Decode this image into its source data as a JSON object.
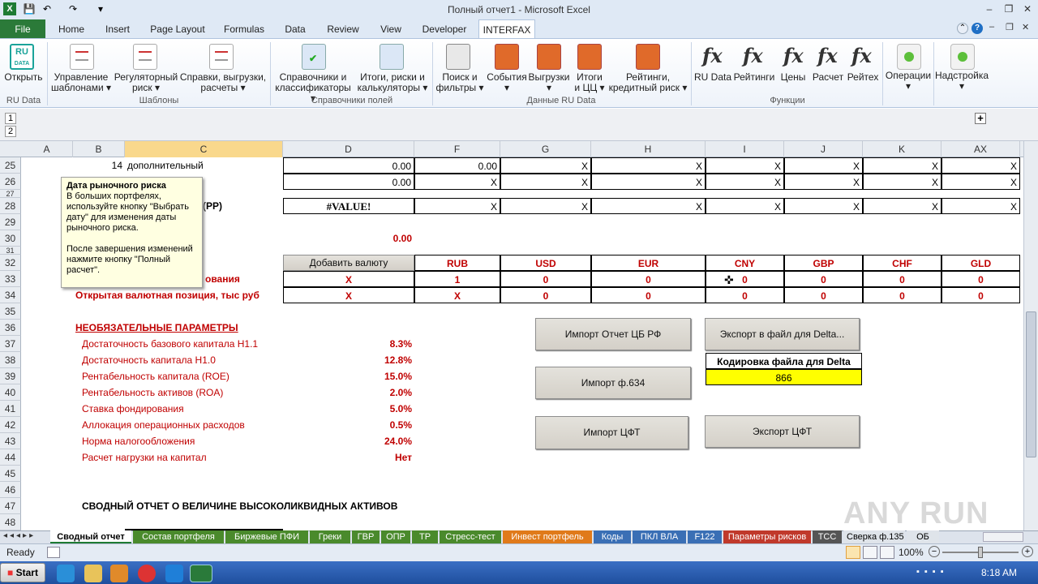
{
  "window": {
    "title": "Полный отчет1 - Microsoft Excel"
  },
  "qat": {
    "save": "💾",
    "undo": "↶",
    "redo": "↷",
    "more": "▾"
  },
  "tabs": [
    "File",
    "Home",
    "Insert",
    "Page Layout",
    "Formulas",
    "Data",
    "Review",
    "View",
    "Developer",
    "INTERFAX"
  ],
  "ribbon": {
    "open": "Открыть",
    "manage": [
      "Управление",
      "шаблонами ▾"
    ],
    "regulatory": [
      "Регуляторный",
      "риск ▾"
    ],
    "reports": [
      "Справки, выгрузки,",
      "расчеты ▾"
    ],
    "dicts": [
      "Справочники и",
      "классификаторы ▾"
    ],
    "totals": [
      "Итоги, риски и",
      "калькуляторы ▾"
    ],
    "search": [
      "Поиск и",
      "фильтры ▾"
    ],
    "events": [
      "События",
      "▾"
    ],
    "exports": [
      "Выгрузки",
      "▾"
    ],
    "itogi": [
      "Итоги",
      "и ЦЦ ▾"
    ],
    "ratings": [
      "Рейтинги,",
      "кредитный риск ▾"
    ],
    "fx_buttons": [
      "RU Data",
      "Рейтинги",
      "Цены",
      "Расчет",
      "Рейтех"
    ],
    "operations": [
      "Операции",
      "▾"
    ],
    "settings": [
      "Надстройка",
      "▾"
    ],
    "groups": [
      "RU Data",
      "Шаблоны",
      "Справочники полей",
      "Данные RU Data",
      "Функции"
    ]
  },
  "outline_levels": [
    "1",
    "2"
  ],
  "columns": [
    "A",
    "B",
    "C",
    "D",
    "F",
    "G",
    "H",
    "I",
    "J",
    "K",
    "AX"
  ],
  "rows": {
    "r25": {
      "num": "25",
      "b": "14",
      "c": "дополнительный",
      "d": "0.00",
      "f": "0.00",
      "x": "X"
    },
    "r26": {
      "num": "26",
      "d": "0.00"
    },
    "r27": {
      "num": "27"
    },
    "r28": {
      "num": "28",
      "c": "(PP)",
      "d": "#VALUE!"
    },
    "r29": {
      "num": "29"
    },
    "r30": {
      "num": "30",
      "d": "0.00"
    },
    "r31": {
      "num": "31"
    },
    "r32": {
      "num": "32",
      "add_currency": "Добавить валюту",
      "currencies": [
        "RUB",
        "USD",
        "EUR",
        "CNY",
        "GBP",
        "CHF",
        "GLD"
      ]
    },
    "r33": {
      "num": "33",
      "label": "ования",
      "d": "X",
      "values": [
        "1",
        "0",
        "0",
        "0",
        "0",
        "0",
        "0"
      ]
    },
    "r34": {
      "num": "34",
      "label": "Открытая валютная позиция, тыс руб",
      "d": "X",
      "values": [
        "X",
        "0",
        "0",
        "0",
        "0",
        "0",
        "0"
      ]
    },
    "r35": {
      "num": "35"
    },
    "r36": {
      "num": "36",
      "label": "НЕОБЯЗАТЕЛЬНЫЕ ПАРАМЕТРЫ"
    },
    "params": [
      {
        "num": "37",
        "label": "Достаточность базового капитала Н1.1",
        "value": "8.3%"
      },
      {
        "num": "38",
        "label": "Достаточность капитала Н1.0",
        "value": "12.8%"
      },
      {
        "num": "39",
        "label": "Рентабельность капитала (ROE)",
        "value": "15.0%"
      },
      {
        "num": "40",
        "label": "Рентабельность активов (ROA)",
        "value": "2.0%"
      },
      {
        "num": "41",
        "label": "Ставка фондирования",
        "value": "5.0%"
      },
      {
        "num": "42",
        "label": "Аллокация операционных расходов",
        "value": "0.5%"
      },
      {
        "num": "43",
        "label": "Норма налогообложения",
        "value": "24.0%"
      },
      {
        "num": "44",
        "label": "Расчет нагрузки на капитал",
        "value": "Нет"
      }
    ],
    "r45": {
      "num": "45"
    },
    "r46": {
      "num": "46"
    },
    "r47": {
      "num": "47",
      "label": "СВОДНЫЙ ОТЧЕТ О ВЕЛИЧИНЕ ВЫСОКОЛИКВИДНЫХ АКТИВОВ"
    },
    "r48": {
      "num": "48"
    }
  },
  "buttons": {
    "import_cbr": "Импорт Отчет ЦБ РФ",
    "export_delta": "Экспорт в файл для Delta...",
    "encoding_label": "Кодировка файла для Delta",
    "encoding_value": "866",
    "import_634": "Импорт ф.634",
    "import_cft": "Импорт ЦФТ",
    "export_cft": "Экспорт ЦФТ"
  },
  "comment": {
    "title": "Дата рыночного риска",
    "body1": "В больших портфелях, используйте кнопку \"Выбрать дату\" для изменения даты рыночного риска.",
    "body2": "После завершения изменений нажмите кнопку \"Полный расчет\"."
  },
  "sheet_tabs": [
    {
      "label": "Сводный отчет",
      "color": "#ffffff",
      "active": true
    },
    {
      "label": "Состав портфеля",
      "color": "#4a8a2c"
    },
    {
      "label": "Биржевые ПФИ",
      "color": "#4a8a2c"
    },
    {
      "label": "Греки",
      "color": "#4a8a2c"
    },
    {
      "label": "ГВР",
      "color": "#4a8a2c"
    },
    {
      "label": "ОПР",
      "color": "#4a8a2c"
    },
    {
      "label": "ТР",
      "color": "#4a8a2c"
    },
    {
      "label": "Стресс-тест",
      "color": "#4a8a2c"
    },
    {
      "label": "Инвест портфель",
      "color": "#e07a1a"
    },
    {
      "label": "Коды",
      "color": "#3a6fb5"
    },
    {
      "label": "ПКЛ ВЛА",
      "color": "#3a6fb5"
    },
    {
      "label": "F122",
      "color": "#3a6fb5"
    },
    {
      "label": "Параметры рисков",
      "color": "#c0392b"
    },
    {
      "label": "ТСС",
      "color": "#555555"
    },
    {
      "label": "Сверка ф.135",
      "color": "#dfe4ea"
    },
    {
      "label": "ОБ",
      "color": "#dfe4ea"
    }
  ],
  "status": {
    "ready": "Ready",
    "zoom": "100%"
  },
  "taskbar": {
    "start": "Start",
    "time": "8:18 AM"
  },
  "watermark": "ANY RUN"
}
